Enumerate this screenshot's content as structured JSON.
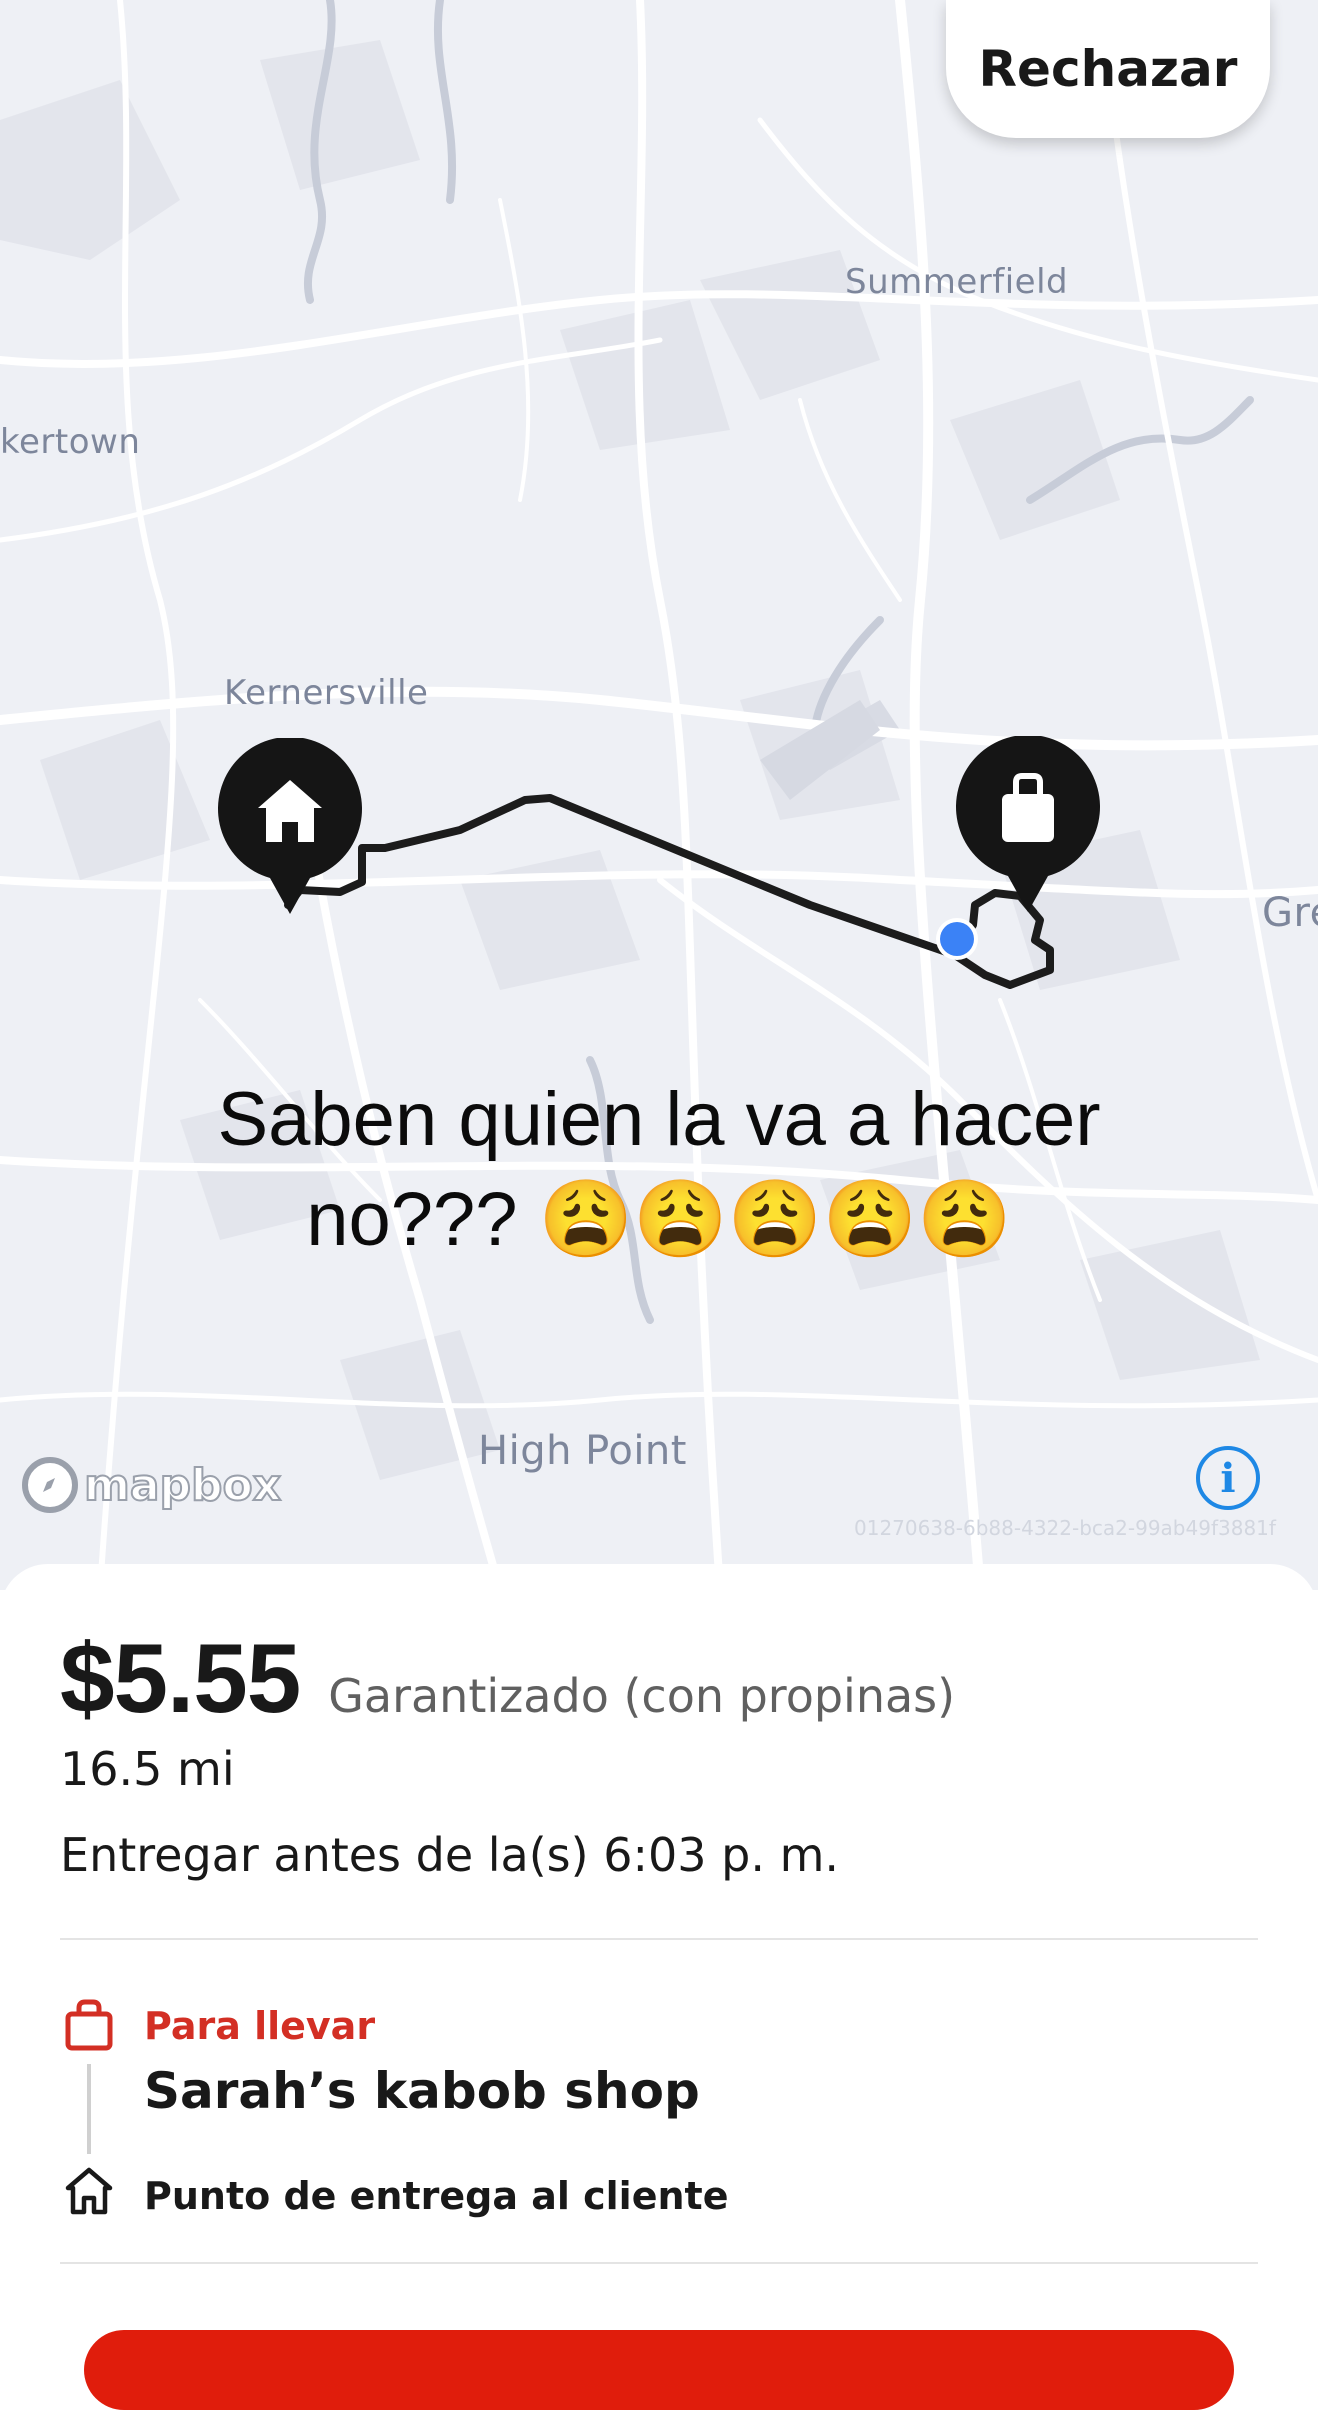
{
  "map": {
    "places": {
      "summerfield": "Summerfield",
      "kernersville_partial": "kertown",
      "kernersville": "Kernersville",
      "greensboro_partial": "Gre",
      "high_point": "High Point"
    },
    "attribution": "mapbox",
    "map_id": "01270638-6b88-4322-bca2-99ab49f3881f",
    "reject_label": "Rechazar"
  },
  "overlay": {
    "line1": "Saben quien la va a hacer",
    "line2": "no??? 😩😩😩😩😩"
  },
  "offer": {
    "price": "$5.55",
    "guarantee": "Garantizado (con propinas)",
    "distance": "16.5 mi",
    "deadline": "Entregar antes de la(s) 6:03 p. m.",
    "pickup_type": "Para llevar",
    "store_name": "Sarah’s kabob shop",
    "dropoff": "Punto de entrega al cliente"
  },
  "colors": {
    "accent_red": "#d32f24",
    "button_red": "#e01d0c",
    "location_blue": "#3b82f6",
    "info_blue": "#1e88e5"
  },
  "icons": [
    "home-icon",
    "shopping-bag-icon",
    "location-dot-icon",
    "info-icon",
    "mapbox-logo-icon"
  ]
}
